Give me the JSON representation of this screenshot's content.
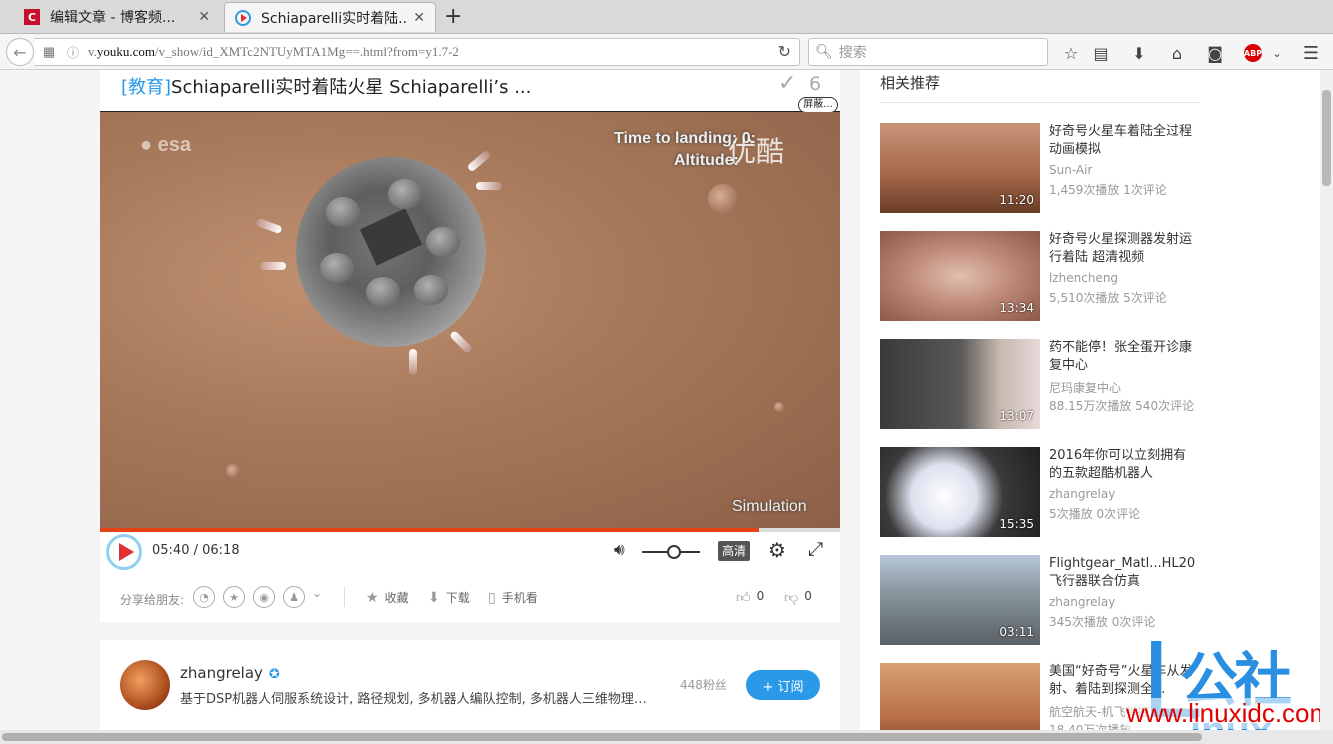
{
  "browser": {
    "tabs": [
      {
        "label": "编辑文章 - 博客频...",
        "favicon": "C",
        "favicon_color": "#c8102e"
      },
      {
        "label": "Schiaparelli实时着陆...",
        "favicon_color": "#2a9ae8"
      }
    ],
    "new_tab": "+",
    "url": {
      "prefix": "v.",
      "host": "youku.com",
      "path": "/v_show/id_XMTc2NTUyMTA1Mg==.html?from=y1.7-2"
    },
    "search_placeholder": "搜索"
  },
  "video_title": {
    "category": "[教育]",
    "text": "Schiaparelli实时着陆火星 Schiaparelli’s ...",
    "count": "6",
    "block_label": "屏蔽..."
  },
  "video_overlay": {
    "time_to_landing": "Time to landing: 0:",
    "altitude": "Altitude:",
    "simulation": "Simulation",
    "esa": "esa",
    "youku": "优酷"
  },
  "player": {
    "current_time": "05:40",
    "separator": " / ",
    "total_time": "06:18",
    "progress": 0.89,
    "hd_label": "高清"
  },
  "share": {
    "label": "分享给朋友:",
    "actions": [
      {
        "label": "收藏"
      },
      {
        "label": "下载"
      },
      {
        "label": "手机看"
      }
    ],
    "likes": "0",
    "dislikes": "0"
  },
  "uploader": {
    "name": "zhangrelay",
    "desc": "基于DSP机器人伺服系统设计, 路径规划, 多机器人编队控制, 多机器人三维物理仿真...",
    "fans": "448粉丝",
    "subscribe": "+ 订阅"
  },
  "related": {
    "heading": "相关推荐",
    "items": [
      {
        "title": "好奇号火星车着陆全过程动画模拟",
        "author": "Sun-Air",
        "stats": "1,459次播放 1次评论",
        "duration": "11:20"
      },
      {
        "title": "好奇号火星探测器发射运行着陆 超清视频",
        "author": "lzhencheng",
        "stats": "5,510次播放 5次评论",
        "duration": "13:34"
      },
      {
        "title": "药不能停！张全蛋开诊康复中心",
        "author": "尼玛康复中心",
        "stats": "88.15万次播放 540次评论",
        "duration": "13:07"
      },
      {
        "title": "2016年你可以立刻拥有的五款超酷机器人",
        "author": "zhangrelay",
        "stats": "5次播放 0次评论",
        "duration": "15:35"
      },
      {
        "title": "Flightgear_Matl...HL20飞行器联合仿真",
        "author": "zhangrelay",
        "stats": "345次播放 0次评论",
        "duration": "03:11"
      },
      {
        "title": "美国“好奇号”火星车从发射、着陆到探测全...",
        "author": "航空航天-机飞弹控",
        "stats": "18.40万次播放 ...",
        "duration": ""
      }
    ]
  },
  "watermark": {
    "logo": "公社",
    "inux": "inux",
    "url": "www.linuxidc.com"
  },
  "colors": {
    "accent": "#2a9ae8",
    "progress": "#e54315",
    "play": "#e03030"
  }
}
